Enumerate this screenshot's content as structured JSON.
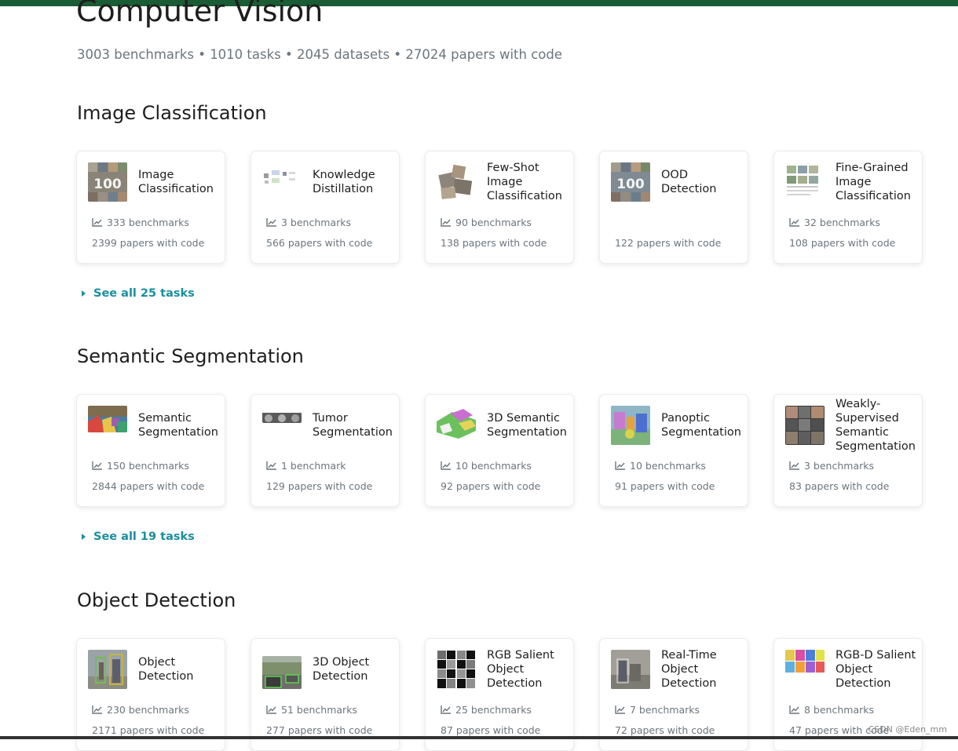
{
  "page": {
    "title": "Computer Vision",
    "stats": "3003 benchmarks • 1010 tasks • 2045 datasets • 27024 papers with code"
  },
  "colors": {
    "accent": "#1a8e9e",
    "topbar": "#1a5c33",
    "muted": "#6c757d"
  },
  "sections": [
    {
      "title": "Image Classification",
      "see_all": "See all 25 tasks",
      "cards": [
        {
          "title": "Image Classification",
          "benchmarks": "333 benchmarks",
          "papers": "2399 papers with code",
          "icon": "line-chart-icon"
        },
        {
          "title": "Knowledge Distillation",
          "benchmarks": "3 benchmarks",
          "papers": "566 papers with code",
          "icon": "line-chart-icon"
        },
        {
          "title": "Few-Shot Image Classification",
          "benchmarks": "90 benchmarks",
          "papers": "138 papers with code",
          "icon": "line-chart-icon"
        },
        {
          "title": "OOD Detection",
          "benchmarks": "",
          "papers": "122 papers with code",
          "icon": "line-chart-icon"
        },
        {
          "title": "Fine-Grained Image Classification",
          "benchmarks": "32 benchmarks",
          "papers": "108 papers with code",
          "icon": "line-chart-icon"
        }
      ]
    },
    {
      "title": "Semantic Segmentation",
      "see_all": "See all 19 tasks",
      "cards": [
        {
          "title": "Semantic Segmentation",
          "benchmarks": "150 benchmarks",
          "papers": "2844 papers with code",
          "icon": "line-chart-icon"
        },
        {
          "title": "Tumor Segmentation",
          "benchmarks": "1 benchmark",
          "papers": "129 papers with code",
          "icon": "line-chart-icon"
        },
        {
          "title": "3D Semantic Segmentation",
          "benchmarks": "10 benchmarks",
          "papers": "92 papers with code",
          "icon": "line-chart-icon"
        },
        {
          "title": "Panoptic Segmentation",
          "benchmarks": "10 benchmarks",
          "papers": "91 papers with code",
          "icon": "line-chart-icon"
        },
        {
          "title": "Weakly-Supervised Semantic Segmentation",
          "benchmarks": "3 benchmarks",
          "papers": "83 papers with code",
          "icon": "line-chart-icon"
        }
      ]
    },
    {
      "title": "Object Detection",
      "see_all": "",
      "cards": [
        {
          "title": "Object Detection",
          "benchmarks": "230 benchmarks",
          "papers": "2171 papers with code",
          "icon": "line-chart-icon"
        },
        {
          "title": "3D Object Detection",
          "benchmarks": "51 benchmarks",
          "papers": "277 papers with code",
          "icon": "line-chart-icon"
        },
        {
          "title": "RGB Salient Object Detection",
          "benchmarks": "25 benchmarks",
          "papers": "87 papers with code",
          "icon": "line-chart-icon"
        },
        {
          "title": "Real-Time Object Detection",
          "benchmarks": "7 benchmarks",
          "papers": "72 papers with code",
          "icon": "line-chart-icon"
        },
        {
          "title": "RGB-D Salient Object Detection",
          "benchmarks": "8 benchmarks",
          "papers": "47 papers with code",
          "icon": "line-chart-icon"
        }
      ]
    }
  ],
  "watermark": "CSDN @Eden_mm"
}
